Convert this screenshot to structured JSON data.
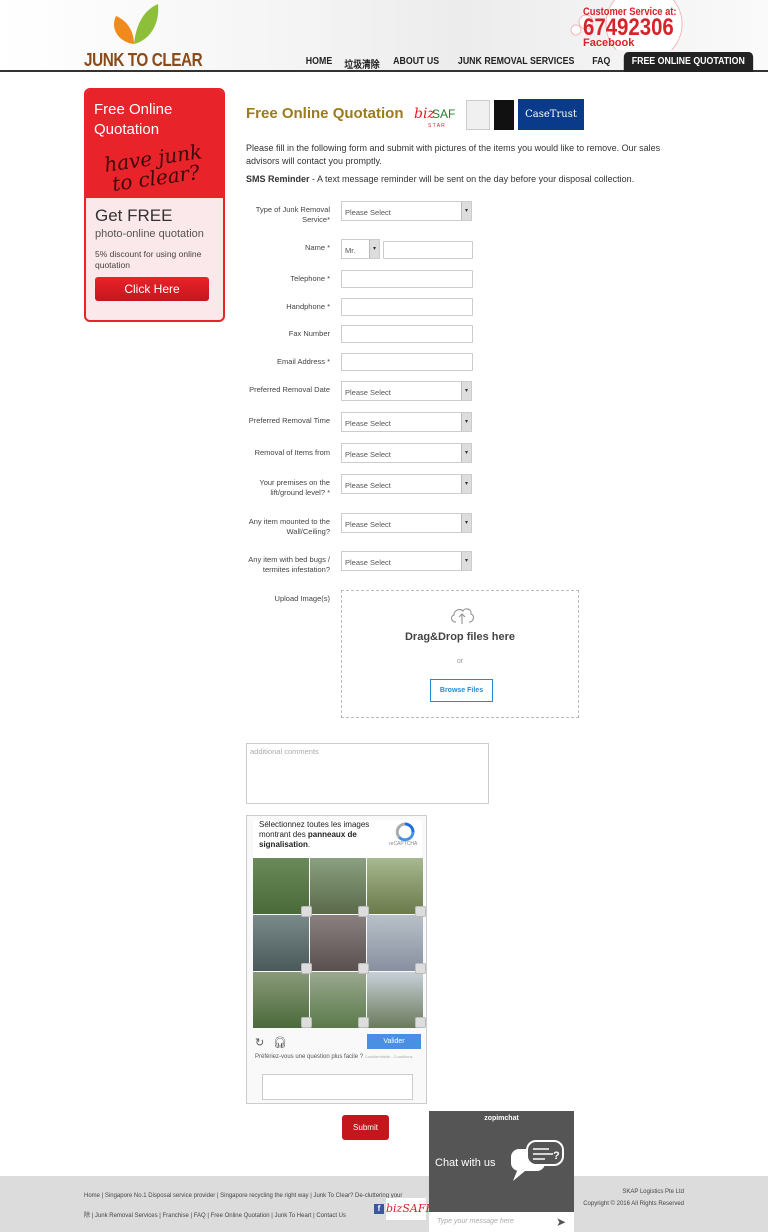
{
  "header": {
    "logo_text": "JUNK TO CLEAR",
    "cs_label": "Customer Service at:",
    "cs_phone": "67492306",
    "cs_fb": "Facebook",
    "nav": [
      "HOME",
      "垃圾清除",
      "ABOUT US",
      "JUNK REMOVAL SERVICES",
      "FAQ",
      "FREE ONLINE QUOTATION"
    ]
  },
  "sidebar": {
    "title": "Free Online Quotation",
    "handwriting": "have junk to clear?",
    "free": "Get FREE",
    "photo": "photo-online quotation",
    "discount": "5% discount for using online quotation",
    "button": "Click Here"
  },
  "main": {
    "title": "Free Online Quotation",
    "badge_casetrust": "CaseTrust",
    "intro": "Please fill in the following form and submit with pictures of the items you would like to remove. Our sales advisors will contact you promptly.",
    "sms_label": "SMS Reminder",
    "sms_text": " - A text message reminder will be sent on the day before your disposal collection."
  },
  "form": {
    "type_label": "Type of Junk Removal Service*",
    "type_value": "Please Select",
    "name_label": "Name *",
    "name_title": "Mr.",
    "telephone_label": "Telephone *",
    "handphone_label": "Handphone *",
    "fax_label": "Fax Number",
    "email_label": "Email Address *",
    "date_label": "Preferred Removal Date",
    "date_value": "Please Select",
    "time_label": "Preferred Removal Time",
    "time_value": "Please Select",
    "from_label": "Removal of Items from",
    "from_value": "Please Select",
    "lift_label": "Your premises on the lift/ground level? *",
    "lift_value": "Please Select",
    "wall_label": "Any item mounted to the Wall/Ceiling?",
    "wall_value": "Please Select",
    "bugs_label": "Any item with bed bugs / termites infestation?",
    "bugs_value": "Please Select",
    "upload_label": "Upload Image(s)",
    "drag": "Drag&Drop files here",
    "or": "or",
    "browse": "Browse Files",
    "comments_placeholder": "additional comments",
    "submit": "Submit"
  },
  "captcha": {
    "inst_a": "Sélectionnez toutes les images montrant des ",
    "inst_b": "panneaux de signalisation",
    "inst_c": ".",
    "recaptcha": "reCAPTCHA",
    "valider": "Valider",
    "pref": "Préfériez-vous une question plus facile ?",
    "terms": "Confidentialité - Conditions"
  },
  "footer": {
    "left_line1": "Home | Singapore No.1 Disposal service provider | Singapore recycling the right way | Junk To Clear? De-cluttering your",
    "left_line2": "除 | Junk Removal Services | Franchise | FAQ | Free Online Quotation | Junk To Heart | Contact Us",
    "company": "SKAP Logistics Pte Ltd",
    "copyright": "Copyright © 2016 All Rights Reserved"
  },
  "chat": {
    "brand": "zopimchat",
    "label": "Chat with us",
    "placeholder": "Type your message here"
  },
  "colors": {
    "brand_red": "#e8232a",
    "title_gold": "#9b7b1a",
    "logo_brown": "#8a4a1a"
  }
}
